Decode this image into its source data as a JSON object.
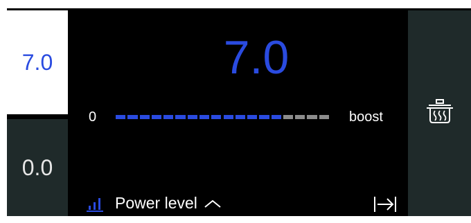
{
  "zones": {
    "active": {
      "label": "7.0"
    },
    "inactive": {
      "label": "0.0"
    }
  },
  "power": {
    "value_display": "7.0",
    "scale_min": "0",
    "scale_max": "boost",
    "level_fraction": 0.78,
    "segments_total": 18,
    "segments_filled": 14
  },
  "bottom": {
    "label": "Power level"
  },
  "icons": {
    "bars": "signal-bars-icon",
    "chevron": "chevron-up-icon",
    "exit": "arrow-to-bar-icon",
    "pot": "pot-heat-icon"
  },
  "colors": {
    "accent": "#2a4be0",
    "inactive_segment": "#8c8c8c",
    "panel": "#1f2a2a",
    "background": "#000000"
  }
}
